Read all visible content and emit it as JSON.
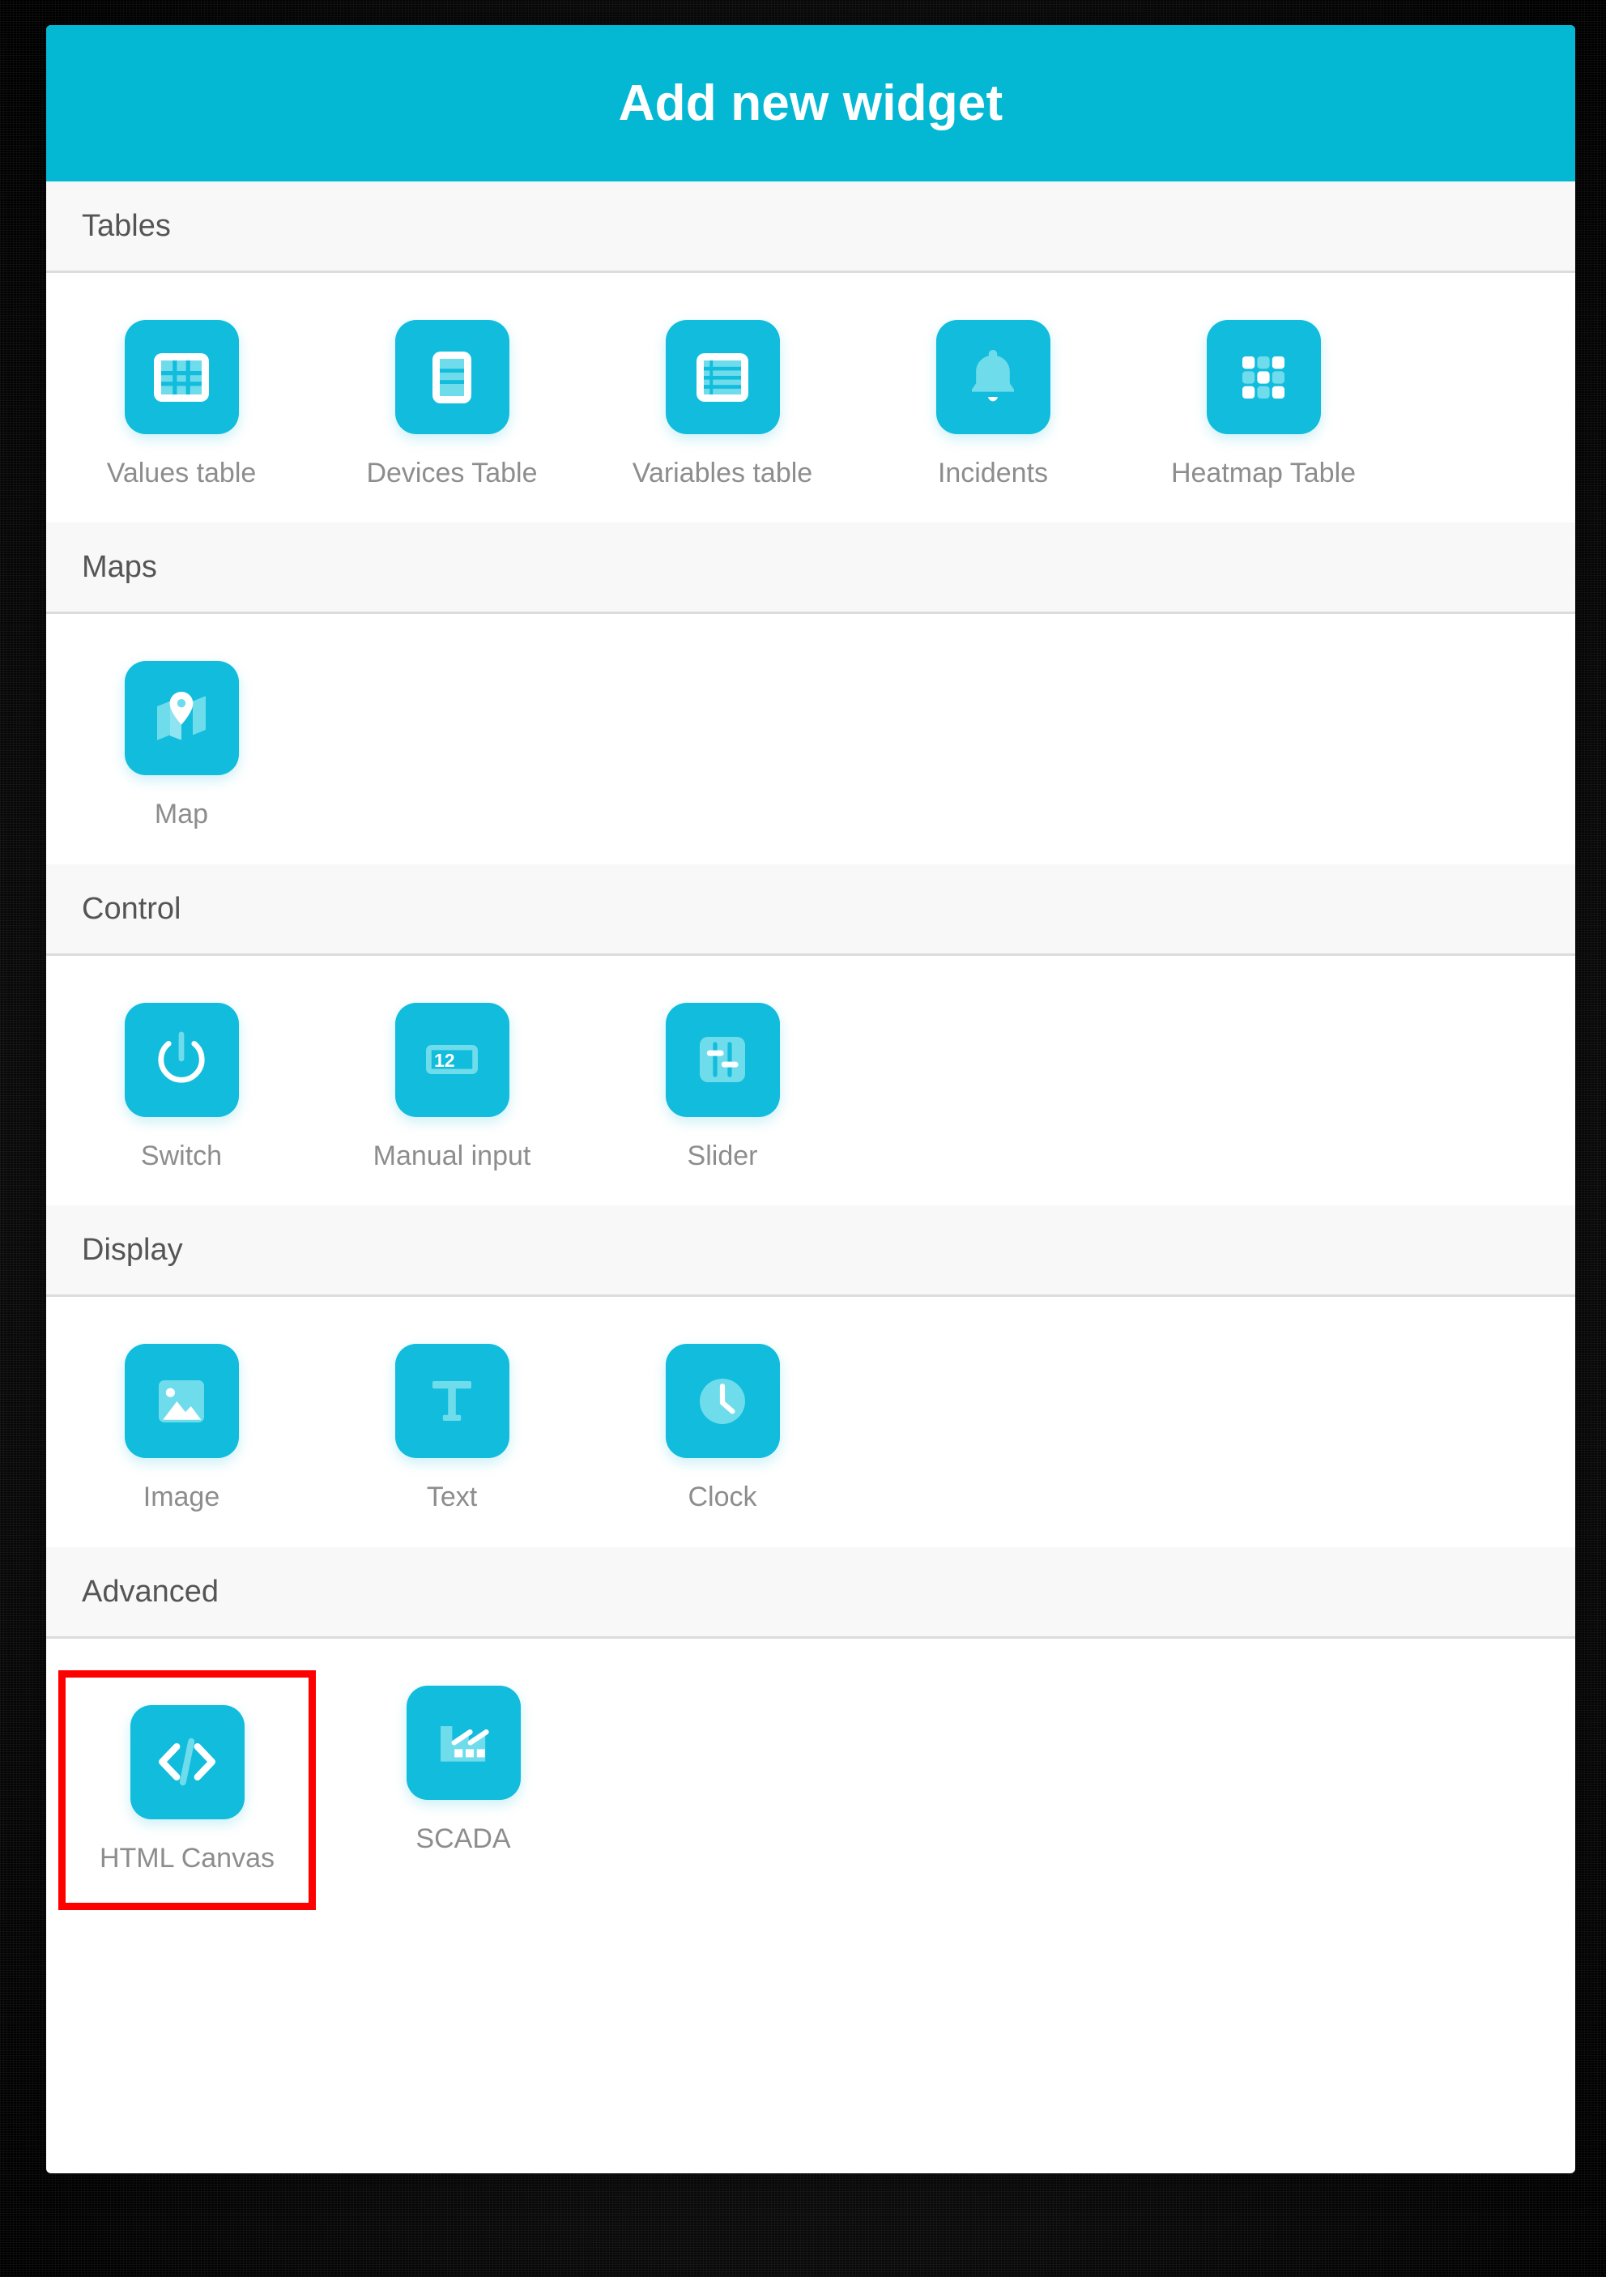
{
  "dialog": {
    "title": "Add new widget",
    "header_color": "#04B8D4",
    "icon_tile_color": "#11BCDC",
    "highlight_color": "#FF0000",
    "label_color": "#8d8d8d",
    "section_title_color": "#555555",
    "section_bg_color": "#f8f8f8"
  },
  "sections": [
    {
      "title": "Tables",
      "items": [
        {
          "label": "Values table",
          "icon": "values-table-icon"
        },
        {
          "label": "Devices Table",
          "icon": "devices-table-icon"
        },
        {
          "label": "Variables table",
          "icon": "variables-table-icon"
        },
        {
          "label": "Incidents",
          "icon": "bell-icon"
        },
        {
          "label": "Heatmap Table",
          "icon": "heatmap-grid-icon"
        }
      ]
    },
    {
      "title": "Maps",
      "items": [
        {
          "label": "Map",
          "icon": "map-pin-icon"
        }
      ]
    },
    {
      "title": "Control",
      "items": [
        {
          "label": "Switch",
          "icon": "power-icon"
        },
        {
          "label": "Manual input",
          "icon": "numeric-input-icon"
        },
        {
          "label": "Slider",
          "icon": "sliders-icon"
        }
      ]
    },
    {
      "title": "Display",
      "items": [
        {
          "label": "Image",
          "icon": "image-icon"
        },
        {
          "label": "Text",
          "icon": "text-t-icon"
        },
        {
          "label": "Clock",
          "icon": "clock-icon"
        }
      ]
    },
    {
      "title": "Advanced",
      "items": [
        {
          "label": "HTML Canvas",
          "icon": "code-brackets-icon",
          "highlighted": true
        },
        {
          "label": "SCADA",
          "icon": "factory-icon"
        }
      ]
    }
  ]
}
